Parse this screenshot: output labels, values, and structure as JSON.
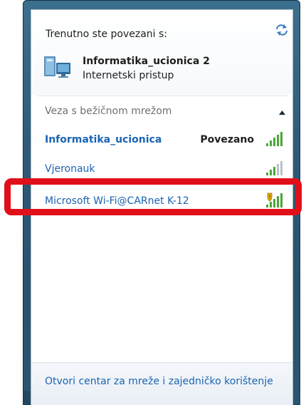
{
  "header": {
    "connected_label": "Trenutno ste povezani s:",
    "current_network": {
      "name": "Informatika_ucionica  2",
      "access": "Internetski pristup"
    }
  },
  "wireless_section": {
    "label": "Veza s bežičnom mrežom",
    "networks": [
      {
        "name": "Informatika_ucionica",
        "status": "Povezano",
        "secured_shield": false,
        "highlighted": false
      },
      {
        "name": "Vjeronauk",
        "status": "",
        "secured_shield": false,
        "highlighted": false
      },
      {
        "name": "Microsoft Wi-Fi@CARnet K-12",
        "status": "",
        "secured_shield": true,
        "highlighted": true
      }
    ]
  },
  "footer": {
    "link": "Otvori centar za mreže i zajedničko korištenje"
  },
  "colors": {
    "link_blue": "#1a63b3",
    "signal_green": "#4aa63a",
    "highlight_red": "#e0101a",
    "shield_yellow": "#f0b400"
  },
  "icons": [
    "refresh-icon",
    "computer-network-icon",
    "collapse-chevron-icon",
    "signal-strength-icon",
    "security-shield-icon"
  ]
}
